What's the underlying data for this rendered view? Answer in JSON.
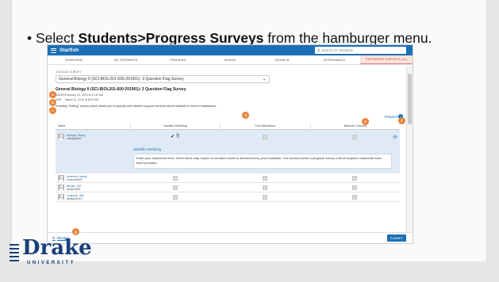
{
  "slide": {
    "bullet_prefix": "Select ",
    "bullet_bold": "Students>Progress Surveys",
    "bullet_suffix": " from the hamburger menu."
  },
  "app": {
    "brand": "Starfish",
    "search_placeholder": "Search for Students"
  },
  "tabs": [
    {
      "label": "OVERVIEW"
    },
    {
      "label": "MY STUDENTS"
    },
    {
      "label": "TRACKING"
    },
    {
      "label": "INTAKE"
    },
    {
      "label": "ZOOM IN"
    },
    {
      "label": "ATTENDANCE"
    },
    {
      "label": "PROGRESS SURVEYS (11)"
    }
  ],
  "survey": {
    "choose_label": "CHOOSE SURVEY",
    "selected": "General Biology II (SCI-BIOL201-600-201901): 3 Question Flag Survey",
    "title": "General Biology II (SCI-BIOL201-600-201901): 3 Question Flag Survey",
    "saved_key": "SAVED",
    "saved_val": "February 10, 2019 at 11:32 AM",
    "due_key": "DUE",
    "due_val": "March 11, 2019 at 8:57 AM",
    "description": "A weekly \"testing\" survey which allows you to quickly alert student support services about students in need of assistance.",
    "search_link": "Search",
    "info": "i"
  },
  "table": {
    "headers": [
      "Name",
      "Worklife Interfering",
      "Poor Attendance",
      "Behavior Concern"
    ],
    "rows": [
      {
        "name": "Albright, Randy",
        "email": "ralbright5083"
      },
      {
        "name": "Andrews, Randy",
        "email": "randrews8287"
      },
      {
        "name": "Berger, Jeff",
        "email": "jberger8399"
      },
      {
        "name": "Chappell, Jeff",
        "email": "jchappell5119"
      }
    ],
    "expand_label": "Worklife Interfering",
    "expand_text": "Enter your comments here. Some items may require a comment which is determined by your institution. You cannot submit a progress survey until all required comments have been provided."
  },
  "footer": {
    "reset": "RESET",
    "submit": "SUBMIT"
  },
  "badges": [
    "a",
    "b",
    "c",
    "d",
    "e",
    "f",
    "g"
  ],
  "logo": {
    "word": "Drake",
    "sub": "UNIVERSITY"
  },
  "colors": {
    "accent": "#1b6fb5",
    "badge": "#e8843a",
    "drake_blue": "#1a3f7a"
  }
}
